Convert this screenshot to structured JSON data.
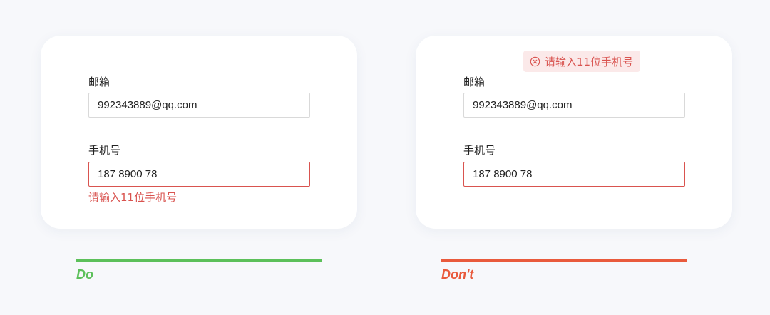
{
  "examples": {
    "do": {
      "email_label": "邮箱",
      "email_value": "992343889@qq.com",
      "phone_label": "手机号",
      "phone_value": "187 8900 78",
      "error_message": "请输入11位手机号",
      "verdict": "Do",
      "accent_color": "#5cc05a"
    },
    "dont": {
      "toast_icon": "close-circle-icon",
      "toast_message": "请输入11位手机号",
      "email_label": "邮箱",
      "email_value": "992343889@qq.com",
      "phone_label": "手机号",
      "phone_value": "187 8900 78",
      "verdict": "Don't",
      "accent_color": "#e95a3c"
    }
  },
  "colors": {
    "error": "#d9534f",
    "error_toast_bg": "#fbe9e9",
    "input_border": "#d9d9d9",
    "page_bg": "#f7f8fb"
  }
}
